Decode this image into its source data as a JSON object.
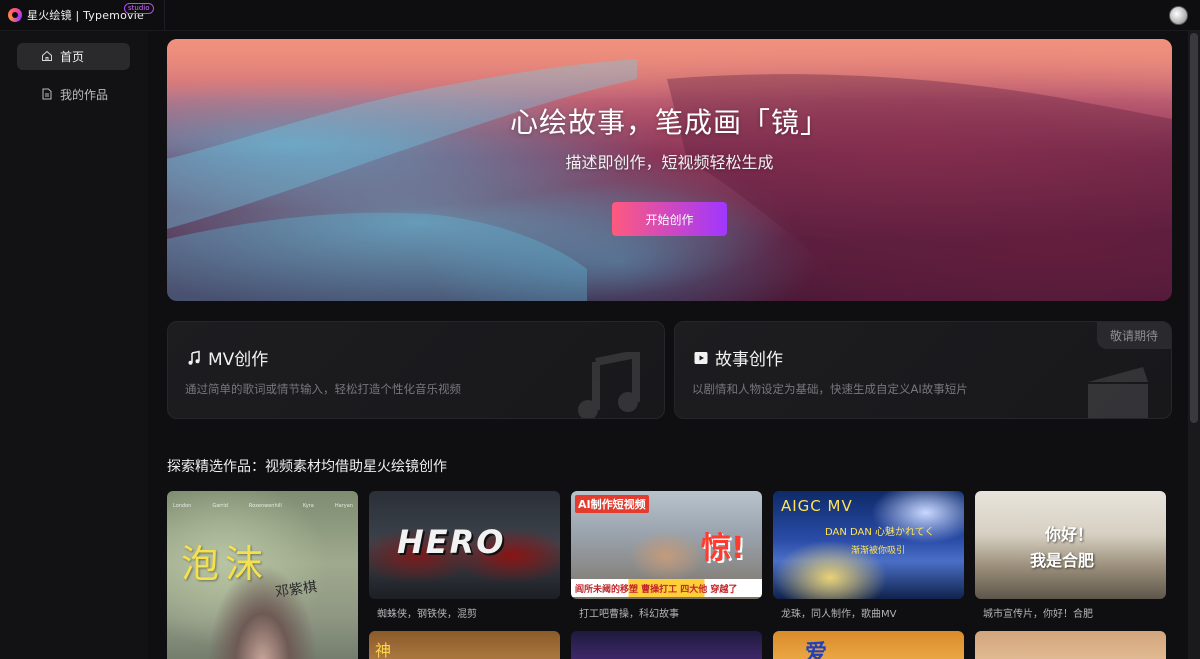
{
  "app": {
    "logo_text": "星火绘镜 | Typemovie",
    "studio_tag": "studio"
  },
  "sidebar": {
    "items": [
      {
        "label": "首页",
        "icon": "home-icon",
        "active": true
      },
      {
        "label": "我的作品",
        "icon": "document-icon",
        "active": false
      }
    ]
  },
  "hero": {
    "title": "心绘故事，笔成画「镜」",
    "subtitle": "描述即创作，短视频轻松生成",
    "cta_label": "开始创作"
  },
  "cards": [
    {
      "title": "MV创作",
      "icon": "music-note-icon",
      "description": "通过简单的歌词或情节输入，轻松打造个性化音乐视频",
      "badge": ""
    },
    {
      "title": "故事创作",
      "icon": "clapperboard-icon",
      "description": "以剧情和人物设定为基础，快速生成自定义AI故事短片",
      "badge": "敬请期待"
    }
  ],
  "gallery": {
    "title": "探索精选作品：视频素材均借助星火绘镜创作",
    "items": [
      {
        "caption": "",
        "overlay": "泡沫",
        "overlay_sub": "邓紫棋",
        "credits": [
          "London",
          "Garrid",
          "Roxenwenhill",
          "Kyra",
          "Haryan"
        ]
      },
      {
        "caption": "蜘蛛侠，钢铁侠，混剪",
        "overlay": "HERO"
      },
      {
        "caption": "打工吧曹操，科幻故事",
        "overlay": "AI制作短视频",
        "overlay_big": "惊!",
        "overlay_bottom": "阎所未阈的移塑 曹操打工 四大他 穿越了"
      },
      {
        "caption": "龙珠，同人制作，歌曲MV",
        "overlay": "AIGC MV",
        "overlay_sub": "DAN DAN 心魅かれてく",
        "overlay_sub2": "渐渐被你吸引"
      },
      {
        "caption": "城市宣传片，你好！合肥",
        "overlay": "你好！",
        "overlay_sub": "我是合肥"
      }
    ],
    "row2": [
      {
        "overlay": "神"
      },
      {
        "overlay": ""
      },
      {
        "overlay": "爱"
      },
      {
        "overlay": ""
      }
    ]
  }
}
